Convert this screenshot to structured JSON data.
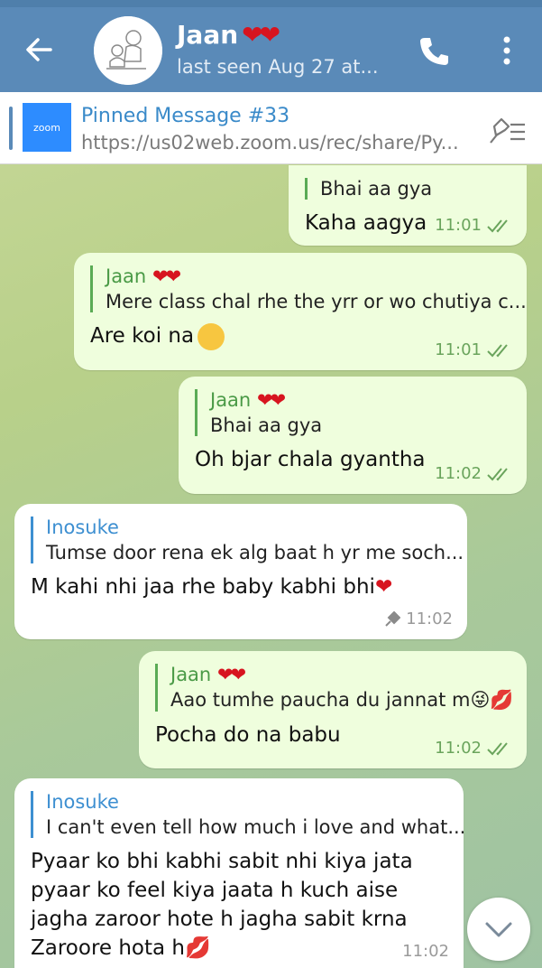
{
  "header": {
    "title": "Jaan",
    "title_hearts": "❤❤",
    "subtitle": "last seen Aug 27 at..."
  },
  "pinned": {
    "title": "Pinned Message #33",
    "text": "https://us02web.zoom.us/rec/share/Py...",
    "thumb_label": "zoom"
  },
  "messages": [
    {
      "reply_text": "Bhai aa gya",
      "text": "Kaha aagya",
      "time": "11:01"
    },
    {
      "reply_name": "Jaan",
      "reply_text": "Mere class chal rhe the yrr or wo chutiya c...",
      "text": "Are koi na",
      "time": "11:01"
    },
    {
      "reply_name": "Jaan",
      "reply_text": "Bhai aa gya",
      "text": "Oh bjar chala gyantha",
      "time": "11:02"
    },
    {
      "reply_name": "Inosuke",
      "reply_text": "Tumse door rena ek alg baat h yr me soch...",
      "text": "M kahi nhi jaa rhe baby kabhi bhi",
      "time": "11:02"
    },
    {
      "reply_name": "Jaan",
      "reply_text": "Aao tumhe paucha du jannat m",
      "text": "Pocha do na babu",
      "time": "11:02"
    },
    {
      "reply_name": "Inosuke",
      "reply_text": "I can't even tell how much i love and what...",
      "line1": "Pyaar ko bhi kabhi sabit nhi kiya jata",
      "line2": "pyaar ko feel kiya jaata h kuch aise",
      "line3": "jagha zaroor hote h jagha sabit krna",
      "line4": "Zaroore hota h",
      "time": "11:02"
    }
  ],
  "colors": {
    "header": "#5a8ab8",
    "outgoing_bubble": "#effedd",
    "incoming_bubble": "#ffffff",
    "accent_green": "#4a9a46",
    "accent_blue": "#3d8fd1"
  }
}
